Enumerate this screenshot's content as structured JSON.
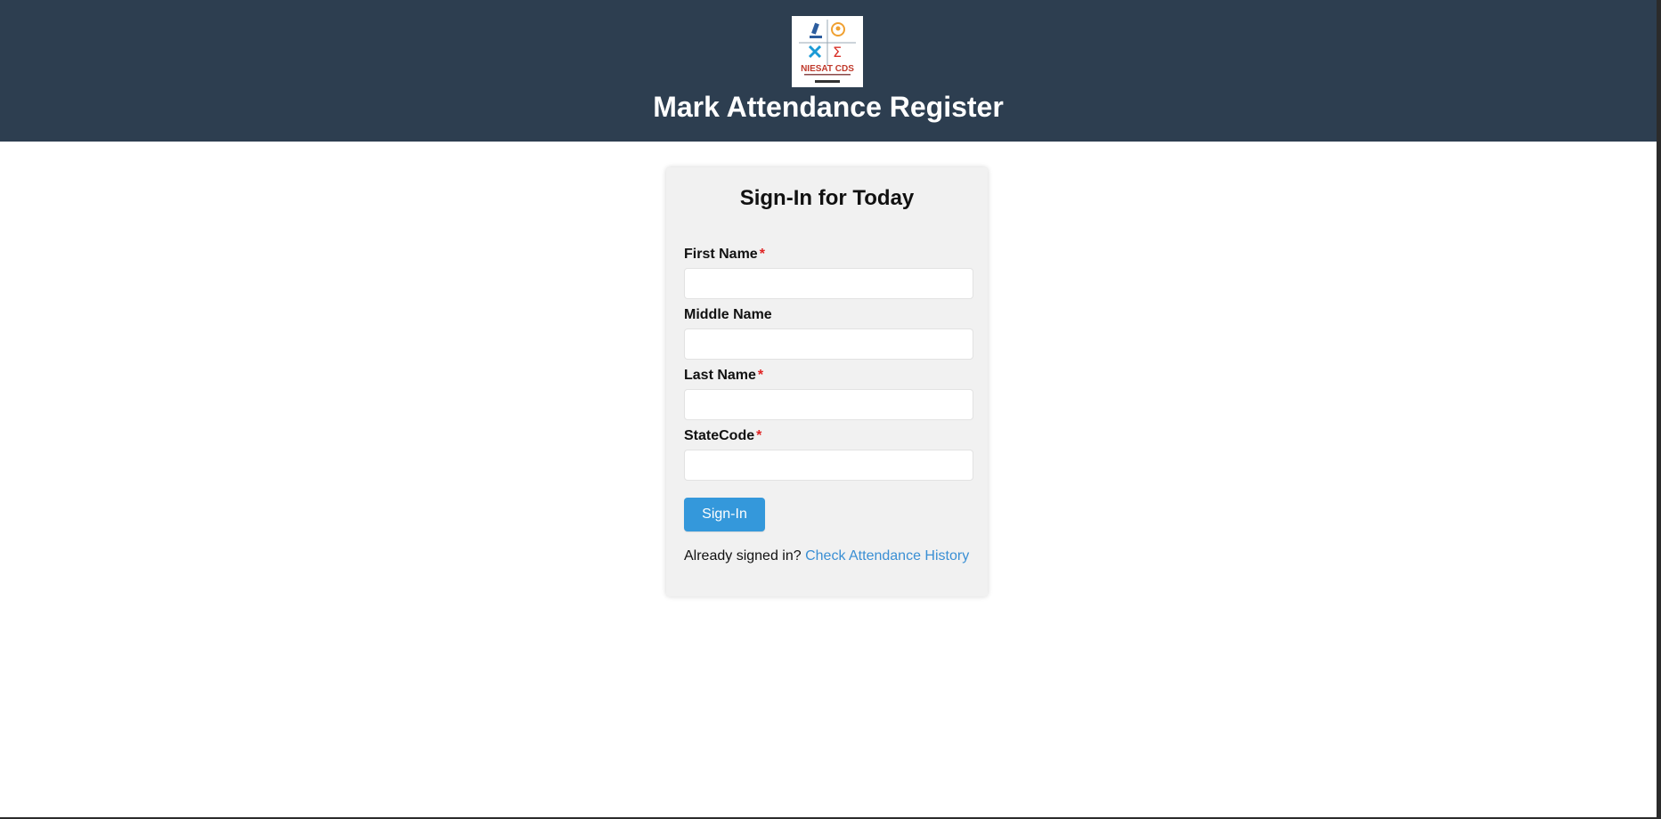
{
  "header": {
    "logo_text": "NIESAT CDS",
    "title": "Mark Attendance Register",
    "background_color": "#2d3e50"
  },
  "form": {
    "title": "Sign-In for Today",
    "required_marker": "*",
    "fields": [
      {
        "label": "First Name",
        "required": true,
        "value": ""
      },
      {
        "label": "Middle Name",
        "required": false,
        "value": ""
      },
      {
        "label": "Last Name",
        "required": true,
        "value": ""
      },
      {
        "label": "StateCode",
        "required": true,
        "value": ""
      }
    ],
    "submit_label": "Sign-In",
    "submit_color": "#3498db",
    "footer_text": "Already signed in?",
    "footer_link": "Check Attendance History"
  }
}
